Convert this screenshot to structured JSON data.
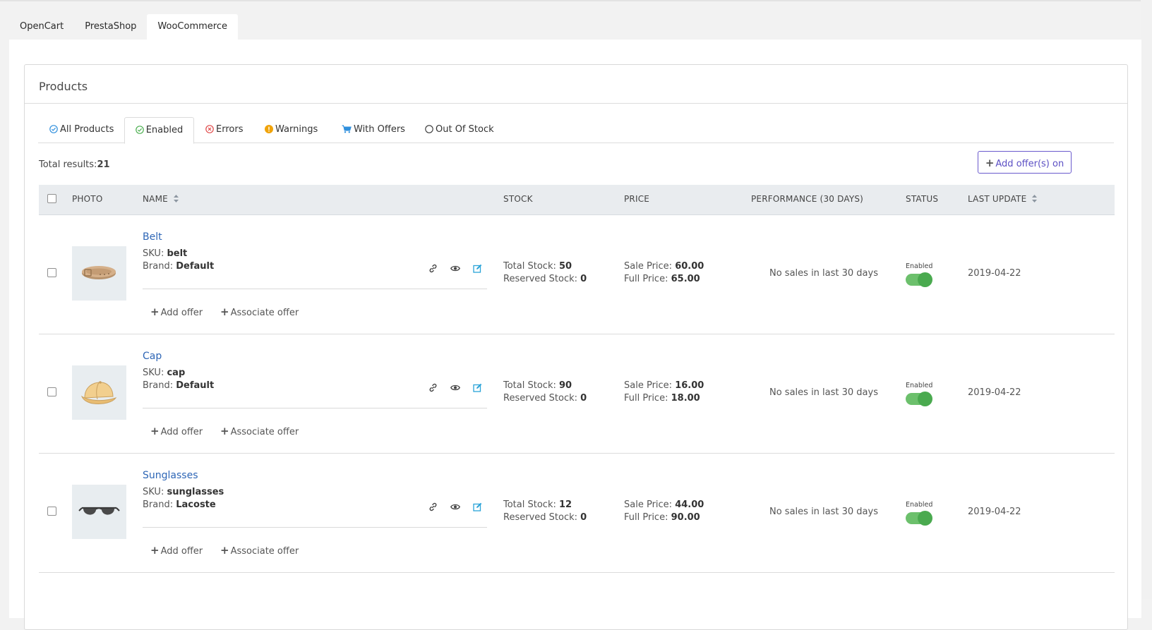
{
  "platform_tabs": [
    "OpenCart",
    "PrestaShop",
    "WooCommerce"
  ],
  "panel_title": "Products",
  "filter_tabs": [
    {
      "label": "All Products",
      "icon": "check-circle-icon",
      "color": "#2f8fdd"
    },
    {
      "label": "Enabled",
      "icon": "check-circle-icon",
      "color": "#4caf50"
    },
    {
      "label": "Errors",
      "icon": "x-circle-icon",
      "color": "#e04a4a"
    },
    {
      "label": "Warnings",
      "icon": "exclamation-circle-icon",
      "color": "#f0a30a"
    },
    {
      "label": "With Offers",
      "icon": "cart-icon",
      "color": "#2f8fdd"
    },
    {
      "label": "Out Of Stock",
      "icon": "empty-circle-icon",
      "color": "#333333"
    }
  ],
  "active_filter": "Enabled",
  "total_results_label": "Total results:",
  "total_results_value": "21",
  "add_offers_button": "Add offer(s) on",
  "columns": {
    "photo": "PHOTO",
    "name": "NAME",
    "stock": "STOCK",
    "price": "PRICE",
    "performance": "PERFORMANCE (30 DAYS)",
    "status": "STATUS",
    "last_update": "LAST UPDATE"
  },
  "labels": {
    "sku": "SKU:",
    "brand": "Brand:",
    "total_stock": "Total Stock:",
    "reserved_stock": "Reserved Stock:",
    "sale_price": "Sale Price:",
    "full_price": "Full Price:",
    "add_offer": "Add offer",
    "associate_offer": "Associate offer",
    "enabled": "Enabled"
  },
  "products": [
    {
      "name": "Belt",
      "sku": "belt",
      "brand": "Default",
      "total_stock": "50",
      "reserved_stock": "0",
      "sale_price": "60.00",
      "full_price": "65.00",
      "performance": "No sales in last 30 days",
      "status": "Enabled",
      "last_update": "2019-04-22",
      "image": "belt-image"
    },
    {
      "name": "Cap",
      "sku": "cap",
      "brand": "Default",
      "total_stock": "90",
      "reserved_stock": "0",
      "sale_price": "16.00",
      "full_price": "18.00",
      "performance": "No sales in last 30 days",
      "status": "Enabled",
      "last_update": "2019-04-22",
      "image": "cap-image"
    },
    {
      "name": "Sunglasses",
      "sku": "sunglasses",
      "brand": "Lacoste",
      "total_stock": "12",
      "reserved_stock": "0",
      "sale_price": "44.00",
      "full_price": "90.00",
      "performance": "No sales in last 30 days",
      "status": "Enabled",
      "last_update": "2019-04-22",
      "image": "sunglasses-image"
    }
  ]
}
